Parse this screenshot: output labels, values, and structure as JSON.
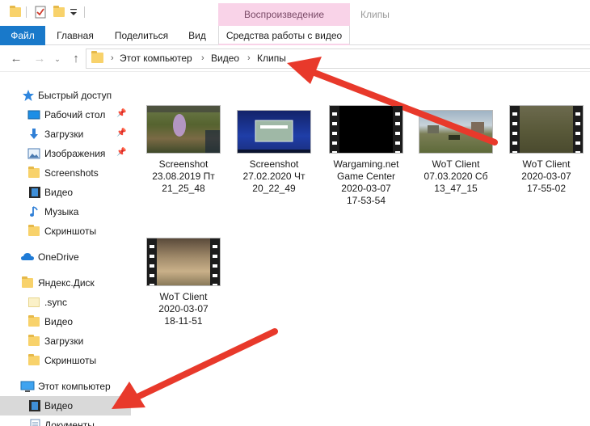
{
  "ribbon": {
    "contextual_group": "Воспроизведение",
    "contextual_title": "Клипы",
    "tabs": [
      {
        "label": "Файл"
      },
      {
        "label": "Главная"
      },
      {
        "label": "Поделиться"
      },
      {
        "label": "Вид"
      },
      {
        "label": "Средства работы с видео"
      }
    ]
  },
  "address": {
    "crumbs": [
      "Этот компьютер",
      "Видео",
      "Клипы"
    ]
  },
  "sidebar": {
    "items": [
      {
        "label": "Быстрый доступ",
        "icon": "star-icon",
        "pinned": false
      },
      {
        "label": "Рабочий стол",
        "icon": "desktop-icon",
        "pinned": true
      },
      {
        "label": "Загрузки",
        "icon": "download-icon",
        "pinned": true
      },
      {
        "label": "Изображения",
        "icon": "pictures-icon",
        "pinned": true
      },
      {
        "label": "Screenshots",
        "icon": "folder-icon",
        "pinned": false
      },
      {
        "label": "Видео",
        "icon": "video-folder-icon",
        "pinned": false
      },
      {
        "label": "Музыка",
        "icon": "music-icon",
        "pinned": false
      },
      {
        "label": "Скриншоты",
        "icon": "folder-icon",
        "pinned": false
      },
      {
        "label": "OneDrive",
        "icon": "cloud-icon",
        "pinned": false
      },
      {
        "label": "Яндекс.Диск",
        "icon": "folder-icon",
        "pinned": false
      },
      {
        "label": ".sync",
        "icon": "folder-icon",
        "pinned": false
      },
      {
        "label": "Видео",
        "icon": "folder-icon",
        "pinned": false
      },
      {
        "label": "Загрузки",
        "icon": "folder-icon",
        "pinned": false
      },
      {
        "label": "Скриншоты",
        "icon": "folder-icon",
        "pinned": false
      },
      {
        "label": "Этот компьютер",
        "icon": "computer-icon",
        "pinned": false
      },
      {
        "label": "Видео",
        "icon": "video-folder-icon",
        "pinned": false,
        "selected": true
      },
      {
        "label": "Документы",
        "icon": "documents-icon",
        "pinned": false
      }
    ]
  },
  "files": [
    {
      "lines": [
        "Screenshot",
        "23.08.2019 Пт",
        "21_25_48"
      ]
    },
    {
      "lines": [
        "Screenshot",
        "27.02.2020 Чт",
        "20_22_49"
      ]
    },
    {
      "lines": [
        "Wargaming.net",
        "Game Center",
        "2020-03-07",
        "17-53-54"
      ]
    },
    {
      "lines": [
        "WoT Client",
        "07.03.2020 Сб",
        "13_47_15"
      ]
    },
    {
      "lines": [
        "WoT Client",
        "2020-03-07",
        "17-55-02"
      ]
    },
    {
      "lines": [
        "WoT Client",
        "2020-03-07",
        "18-11-51"
      ]
    }
  ],
  "colors": {
    "accent": "#1979ca",
    "contextual": "#f9d3e8",
    "arrow": "#e8392b",
    "selected": "#d9d9d9"
  }
}
